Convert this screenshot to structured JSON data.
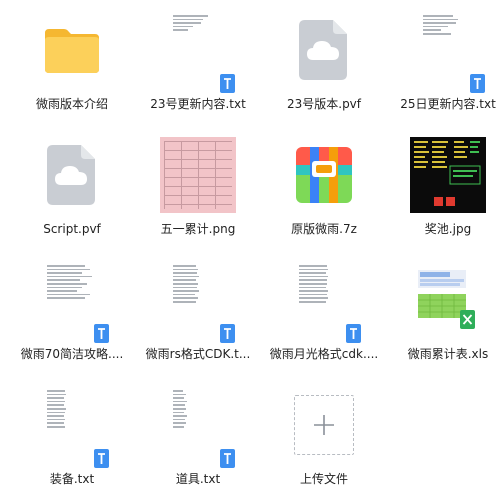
{
  "files": [
    {
      "label": "微雨版本介绍",
      "icon": "folder-icon"
    },
    {
      "label": "23号更新内容.txt",
      "icon": "txt-file-icon"
    },
    {
      "label": "23号版本.pvf",
      "icon": "cloud-file-icon"
    },
    {
      "label": "25日更新内容.txt",
      "icon": "txt-file-icon"
    },
    {
      "label": "Script.pvf",
      "icon": "cloud-file-icon"
    },
    {
      "label": "五一累计.png",
      "icon": "image-thumbnail"
    },
    {
      "label": "原版微雨.7z",
      "icon": "archive-icon"
    },
    {
      "label": "奖池.jpg",
      "icon": "image-thumbnail"
    },
    {
      "label": "微雨70简洁攻略....",
      "icon": "txt-file-icon"
    },
    {
      "label": "微雨rs格式CDK.t...",
      "icon": "txt-file-icon"
    },
    {
      "label": "微雨月光格式cdk....",
      "icon": "txt-file-icon"
    },
    {
      "label": "微雨累计表.xls",
      "icon": "xls-file-icon"
    },
    {
      "label": "装备.txt",
      "icon": "txt-file-icon"
    },
    {
      "label": "道具.txt",
      "icon": "txt-file-icon"
    },
    {
      "label": "上传文件",
      "icon": "plus-icon"
    }
  ],
  "colors": {
    "folder": "#f9c744",
    "txt_badge": "#3d8ff0",
    "xls_badge": "#2fae5a",
    "cloud_doc": "#c7cbd1"
  }
}
